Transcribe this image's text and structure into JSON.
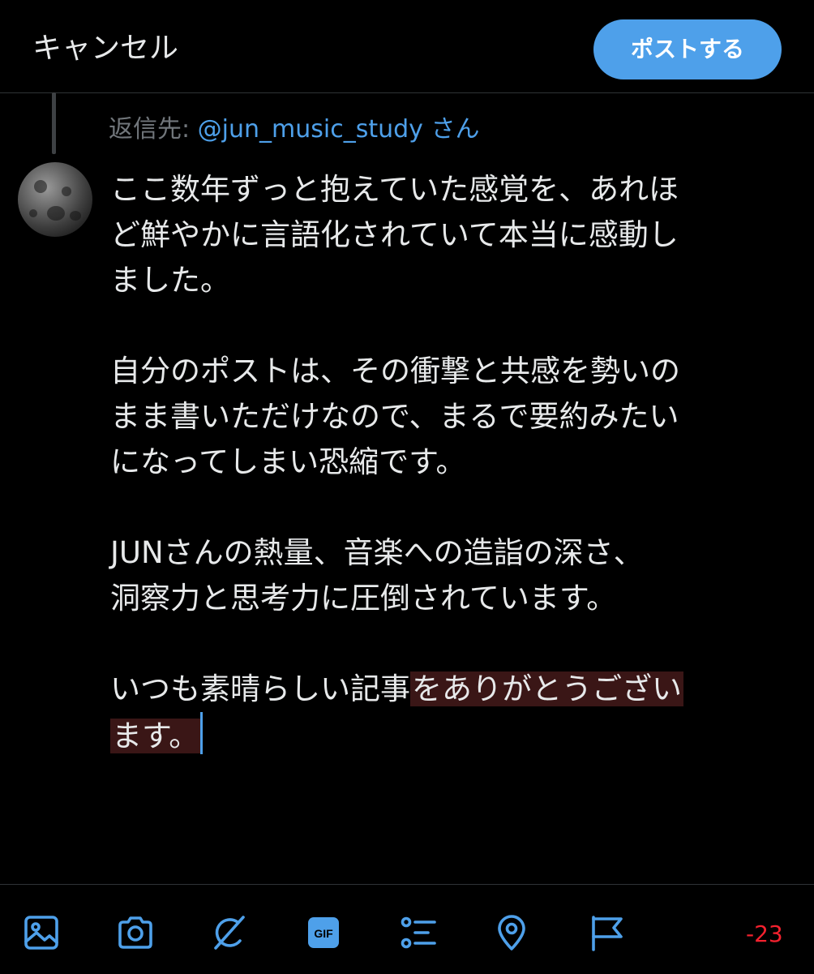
{
  "header": {
    "cancel_label": "キャンセル",
    "post_label": "ポストする"
  },
  "reply": {
    "label": "返信先:",
    "handle": "@jun_music_study",
    "suffix": "さん"
  },
  "compose": {
    "paragraph1": [
      "ここ数年ずっと抱えていた感覚を、あれほ",
      "ど鮮やかに言語化されていて本当に感動し",
      "ました。"
    ],
    "paragraph2": [
      "自分のポストは、その衝撃と共感を勢いの",
      "まま書いただけなので、まるで要約みたい",
      "になってしまい恐縮です。"
    ],
    "paragraph3": [
      "JUNさんの熱量、音楽への造詣の深さ、",
      "洞察力と思考力に圧倒されています。"
    ],
    "paragraph4_normal": "いつも素晴らしい記事",
    "paragraph4_overflow_line1": "をありがとうござい",
    "paragraph4_overflow_line2": "ます。"
  },
  "toolbar": {
    "icons": [
      "image-icon",
      "camera-icon",
      "grok-icon",
      "gif-icon",
      "poll-icon",
      "location-icon",
      "flag-icon"
    ],
    "char_count": "-23"
  },
  "colors": {
    "accent": "#4ea0ea",
    "overflow_bg": "#3a1616",
    "error": "#f4212e",
    "muted": "#71767b",
    "text": "#e7e9ea"
  }
}
